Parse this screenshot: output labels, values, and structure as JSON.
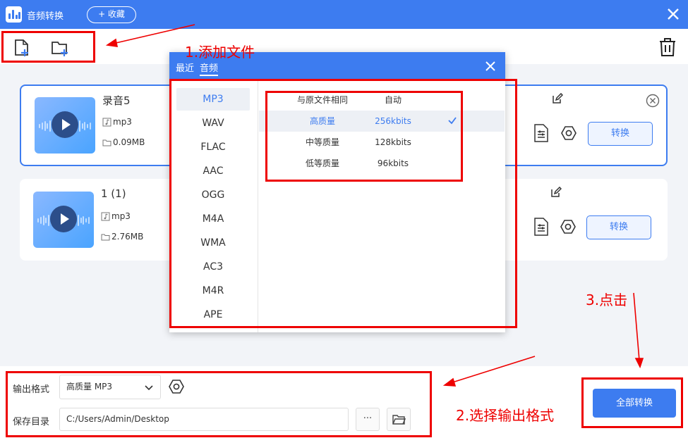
{
  "app": {
    "title": "音频转换",
    "favorite_label": "+ 收藏"
  },
  "files": [
    {
      "name": "录音5",
      "format": "mp3",
      "size": "0.09MB",
      "tail": ")",
      "convert_label": "转换"
    },
    {
      "name": "1 (1)",
      "format": "mp3",
      "size": "2.76MB",
      "tail": ")",
      "convert_label": "转换"
    }
  ],
  "popup": {
    "tabs": [
      "最近",
      "音频"
    ],
    "formats": [
      "MP3",
      "WAV",
      "FLAC",
      "AAC",
      "OGG",
      "M4A",
      "WMA",
      "AC3",
      "M4R",
      "APE"
    ],
    "selected_format": "MP3",
    "qualities": [
      {
        "name": "与原文件相同",
        "rate": "自动"
      },
      {
        "name": "高质量",
        "rate": "256kbits"
      },
      {
        "name": "中等质量",
        "rate": "128kbits"
      },
      {
        "name": "低等质量",
        "rate": "96kbits"
      }
    ],
    "selected_quality": "高质量"
  },
  "bottom": {
    "format_label": "输出格式",
    "format_value": "高质量 MP3",
    "dir_label": "保存目录",
    "dir_value": "C:/Users/Admin/Desktop",
    "more_label": "···",
    "convert_all_label": "全部转换"
  },
  "annotations": {
    "step1": "1.添加文件",
    "step2": "2.选择输出格式",
    "step3": "3.点击",
    "color": "#e00000"
  },
  "colors": {
    "accent": "#3d7cf0"
  }
}
